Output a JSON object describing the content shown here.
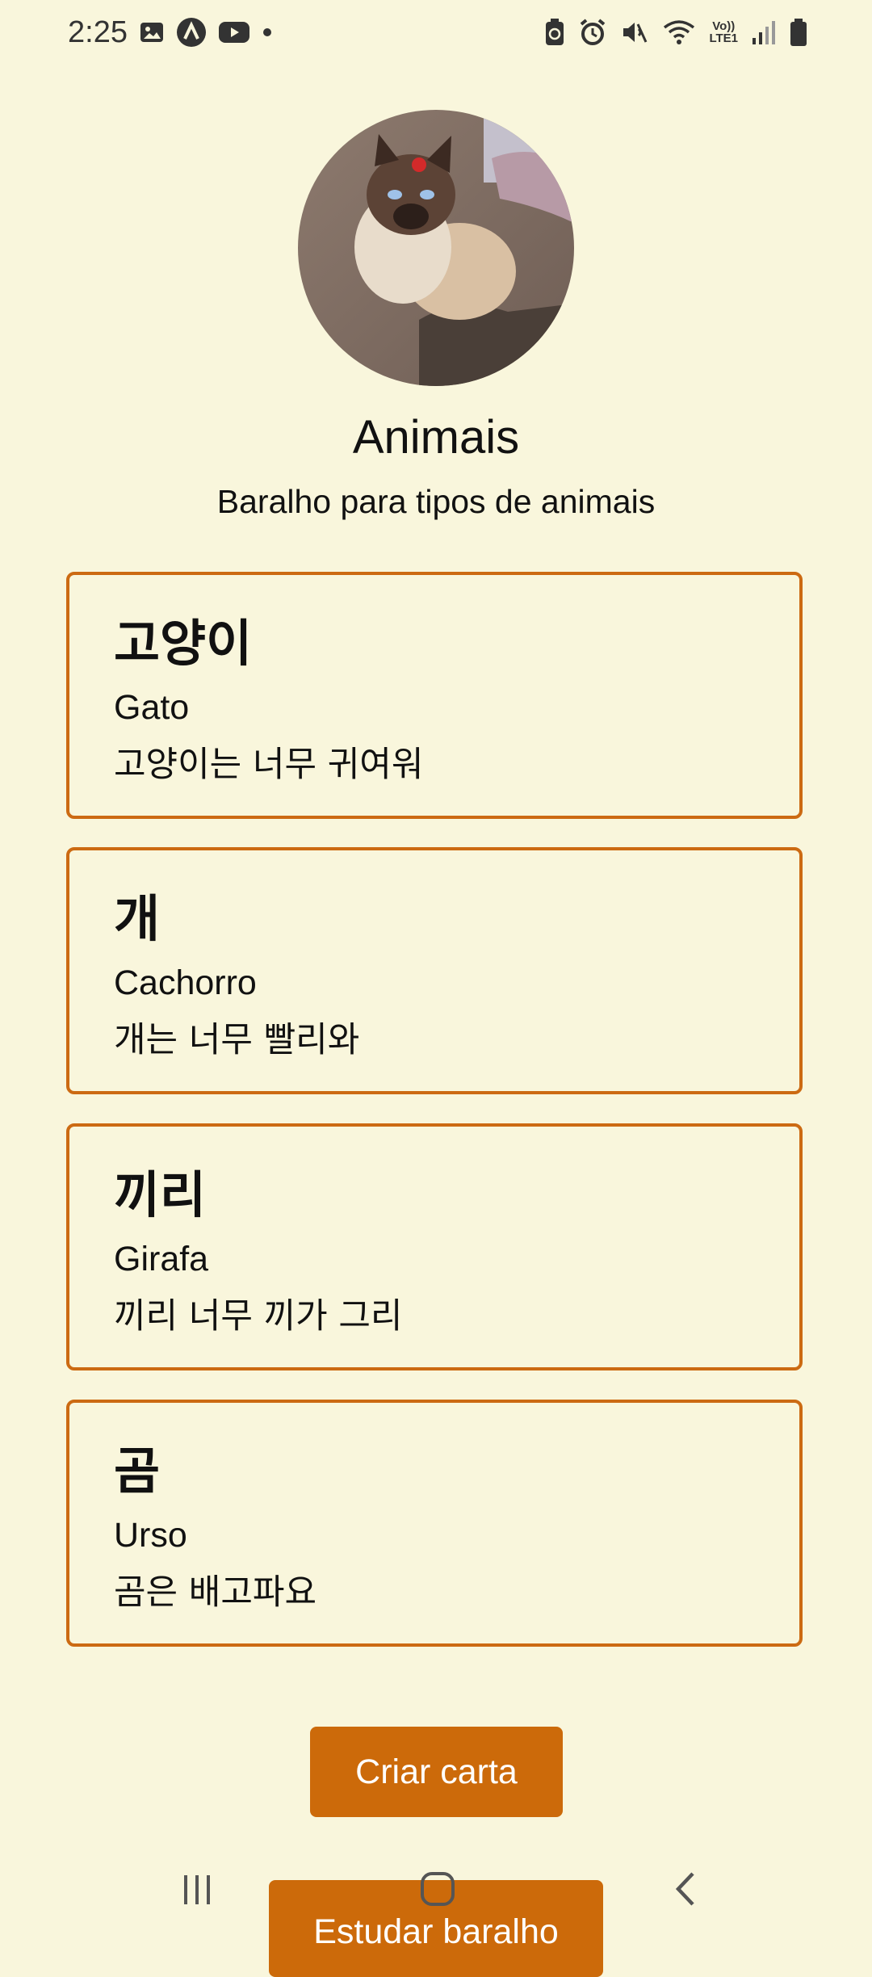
{
  "status_bar": {
    "time": "2:25",
    "left_icons": [
      "image-icon",
      "app-logo-icon",
      "youtube-icon",
      "notification-dot-icon"
    ],
    "right_icons": [
      "battery-saver-icon",
      "alarm-icon",
      "mute-icon",
      "wifi-icon",
      "volte-icon",
      "signal-icon",
      "battery-icon"
    ],
    "volte_top": "Vo))",
    "volte_bottom": "LTE1"
  },
  "deck": {
    "image": "siamese-cat-photo",
    "title": "Animais",
    "description": "Baralho para tipos de animais"
  },
  "cards": [
    {
      "front": "고양이",
      "back": "Gato",
      "example": "고양이는 너무 귀여워"
    },
    {
      "front": "개",
      "back": "Cachorro",
      "example": "개는 너무 빨리와"
    },
    {
      "front": "끼리",
      "back": "Girafa",
      "example": "끼리 너무 끼가 그리"
    },
    {
      "front": "곰",
      "back": "Urso",
      "example": "곰은 배고파요"
    }
  ],
  "actions": {
    "create_card": "Criar carta",
    "study_deck": "Estudar baralho"
  },
  "nav_bar": [
    "recents-icon",
    "home-icon",
    "back-icon"
  ],
  "colors": {
    "background": "#f9f6dc",
    "accent": "#cc6a0a"
  }
}
